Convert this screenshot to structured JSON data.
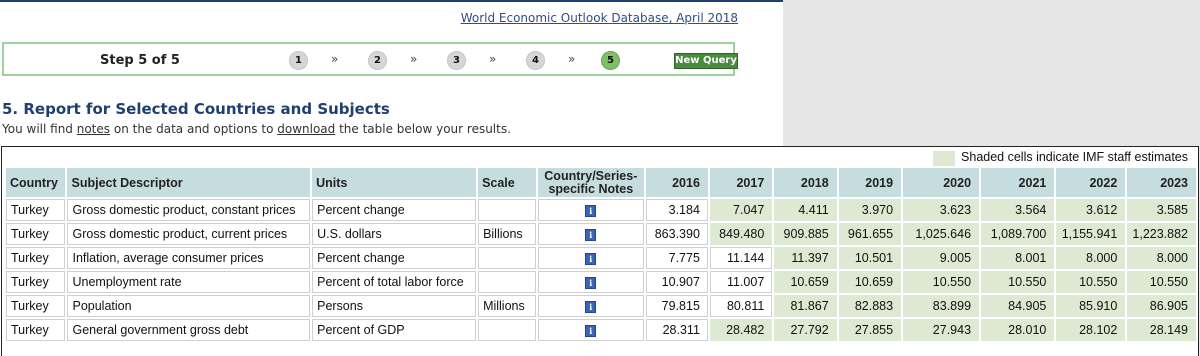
{
  "header": {
    "db_link": "World Economic Outlook Database, April 2018"
  },
  "steps": {
    "title": "Step 5 of 5",
    "items": [
      "1",
      "2",
      "3",
      "4",
      "5"
    ],
    "arrow": "»",
    "new_query": "New Query"
  },
  "report": {
    "heading": "5. Report for Selected Countries and Subjects",
    "sub_prefix": "You will find ",
    "notes_link": "notes",
    "sub_middle": " on the data and options to ",
    "download_link": "download",
    "sub_suffix": " the table below your results."
  },
  "legend": {
    "text": "Shaded cells indicate IMF staff estimates",
    "shade_color": "#dde9d3"
  },
  "table": {
    "columns": {
      "country": "Country",
      "subject": "Subject Descriptor",
      "units": "Units",
      "scale": "Scale",
      "notes_line1": "Country/Series-",
      "notes_line2": "specific Notes"
    },
    "years": [
      "2016",
      "2017",
      "2018",
      "2019",
      "2020",
      "2021",
      "2022",
      "2023"
    ],
    "rows": [
      {
        "country": "Turkey",
        "subject": "Gross domestic product, constant prices",
        "units": "Percent change",
        "scale": "",
        "values": [
          "3.184",
          "7.047",
          "4.411",
          "3.970",
          "3.623",
          "3.564",
          "3.612",
          "3.585"
        ],
        "shade_from": 1
      },
      {
        "country": "Turkey",
        "subject": "Gross domestic product, current prices",
        "units": "U.S. dollars",
        "scale": "Billions",
        "values": [
          "863.390",
          "849.480",
          "909.885",
          "961.655",
          "1,025.646",
          "1,089.700",
          "1,155.941",
          "1,223.882"
        ],
        "shade_from": 1
      },
      {
        "country": "Turkey",
        "subject": "Inflation, average consumer prices",
        "units": "Percent change",
        "scale": "",
        "values": [
          "7.775",
          "11.144",
          "11.397",
          "10.501",
          "9.005",
          "8.001",
          "8.000",
          "8.000"
        ],
        "shade_from": 2
      },
      {
        "country": "Turkey",
        "subject": "Unemployment rate",
        "units": "Percent of total labor force",
        "scale": "",
        "values": [
          "10.907",
          "11.007",
          "10.659",
          "10.659",
          "10.550",
          "10.550",
          "10.550",
          "10.550"
        ],
        "shade_from": 2
      },
      {
        "country": "Turkey",
        "subject": "Population",
        "units": "Persons",
        "scale": "Millions",
        "values": [
          "79.815",
          "80.811",
          "81.867",
          "82.883",
          "83.899",
          "84.905",
          "85.910",
          "86.905"
        ],
        "shade_from": 2
      },
      {
        "country": "Turkey",
        "subject": "General government gross debt",
        "units": "Percent of GDP",
        "scale": "",
        "values": [
          "28.311",
          "28.482",
          "27.792",
          "27.855",
          "27.943",
          "28.010",
          "28.102",
          "28.149"
        ],
        "shade_from": 1
      }
    ],
    "info_icon": "i"
  }
}
